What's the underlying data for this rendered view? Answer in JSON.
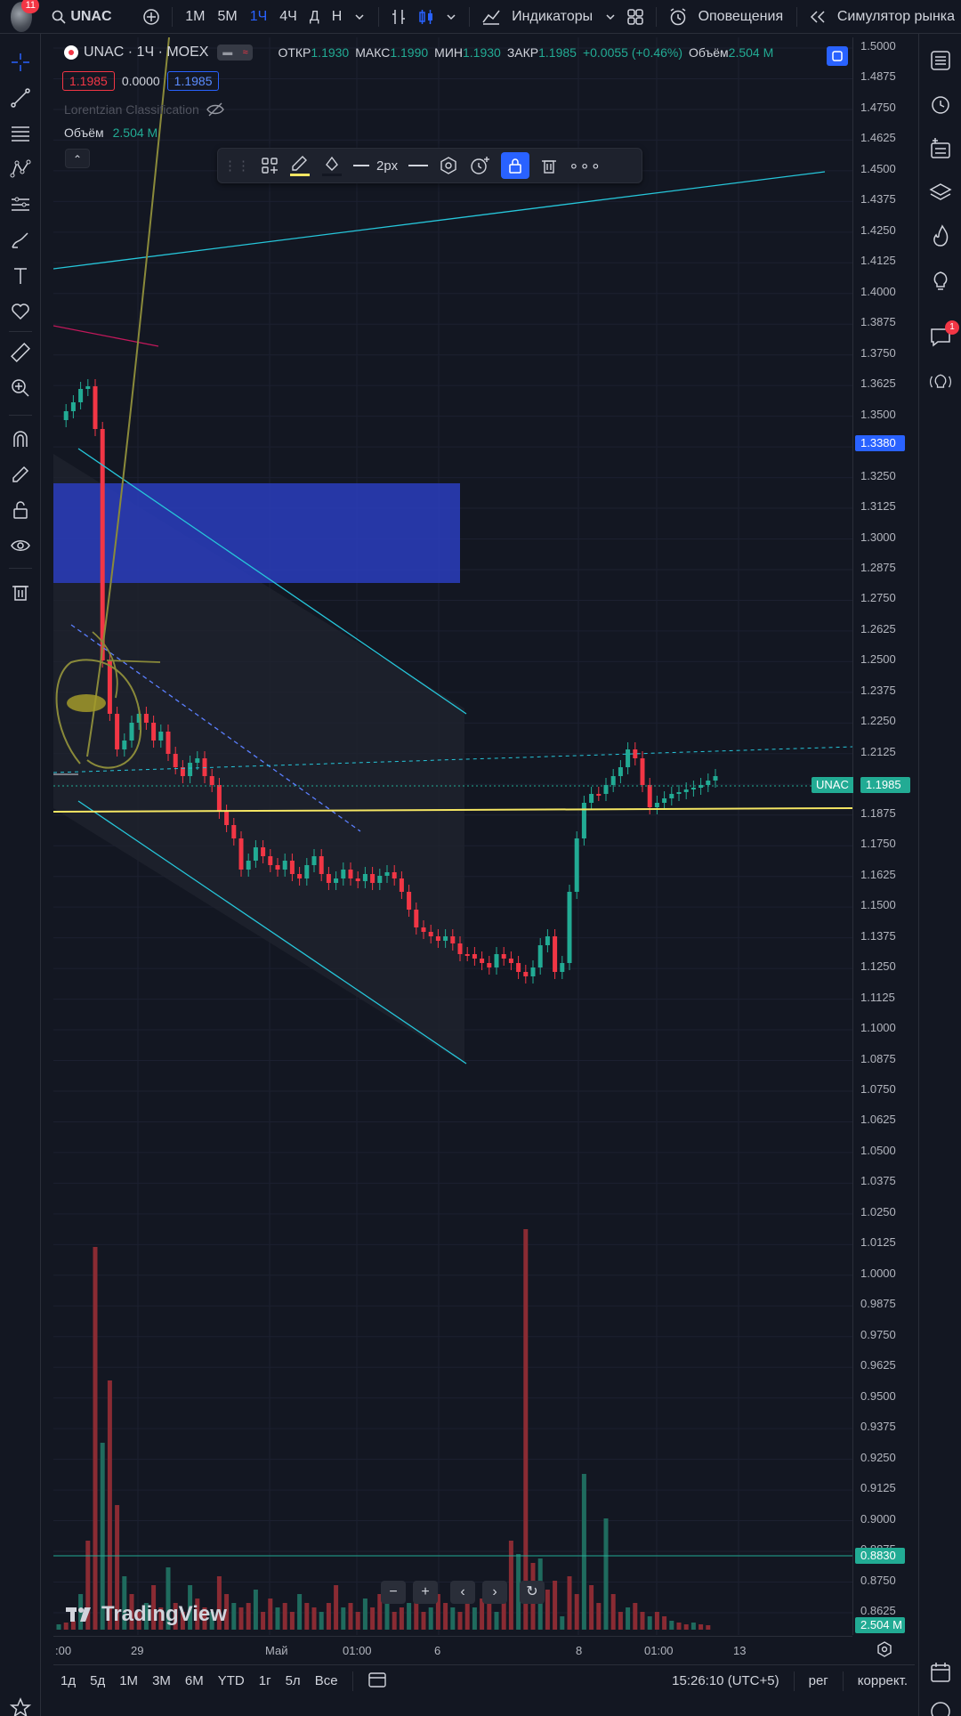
{
  "topbar": {
    "notifications": "11",
    "symbol": "UNAC",
    "intervals": [
      "1М",
      "5М",
      "1Ч",
      "4Ч",
      "Д",
      "Н"
    ],
    "active_interval": "1Ч",
    "indicators": "Индикаторы",
    "alerts": "Оповещения",
    "simulator": "Симулятор рынка"
  },
  "legend": {
    "title": "UNAC · 1Ч · MOEX",
    "open_k": "ОТКР",
    "open_v": "1.1930",
    "high_k": "МАКС",
    "high_v": "1.1990",
    "low_k": "МИН",
    "low_v": "1.1930",
    "close_k": "ЗАКР",
    "close_v": "1.1985",
    "change": "+0.0055 (+0.46%)",
    "vol_k": "Объём",
    "vol_v": "2.504 M",
    "bid": "1.1985",
    "spread": "0.0000",
    "ask": "1.1985",
    "indicator": "Lorentzian Classification",
    "volume_label": "Объём",
    "volume_value": "2.504 M"
  },
  "drawing_toolbar": {
    "width_label": "2px"
  },
  "price_axis": {
    "ticks": [
      "1.5000",
      "1.4875",
      "1.4750",
      "1.4625",
      "1.4500",
      "1.4375",
      "1.4250",
      "1.4125",
      "1.4000",
      "1.3875",
      "1.3750",
      "1.3625",
      "1.3500",
      "1.3375",
      "1.3250",
      "1.3125",
      "1.3000",
      "1.2875",
      "1.2750",
      "1.2625",
      "1.2500",
      "1.2375",
      "1.2250",
      "1.2125",
      "1.2000",
      "1.1875",
      "1.1750",
      "1.1625",
      "1.1500",
      "1.1375",
      "1.1250",
      "1.1125",
      "1.1000",
      "1.0875",
      "1.0750",
      "1.0625",
      "1.0500",
      "1.0375",
      "1.0250",
      "1.0125",
      "1.0000",
      "0.9875",
      "0.9750",
      "0.9625",
      "0.9500",
      "0.9375",
      "0.9250",
      "0.9125",
      "0.9000",
      "0.8875",
      "0.8750",
      "0.8625"
    ],
    "label_top": "1.3380",
    "label_symbol": "UNAC",
    "label_price": "1.1985",
    "label_line": "0.8830",
    "label_volume": "2.504 M"
  },
  "time_axis": {
    "ticks": [
      ":00",
      "29",
      "Май",
      "01:00",
      "6",
      "8",
      "01:00",
      "13"
    ]
  },
  "watermark": "TradingView",
  "bottom": {
    "ranges": [
      "1д",
      "5д",
      "1М",
      "3М",
      "6М",
      "YTD",
      "1г",
      "5л",
      "Все"
    ],
    "time": "15:26:10 (UTC+5)",
    "session": "рег",
    "adjust": "коррект."
  },
  "right_badge": "1",
  "colors": {
    "up": "#22ab94",
    "down": "#f23645",
    "accent": "#2962ff",
    "yellow_line": "#f5e663",
    "cyan_line": "#26c6da"
  }
}
